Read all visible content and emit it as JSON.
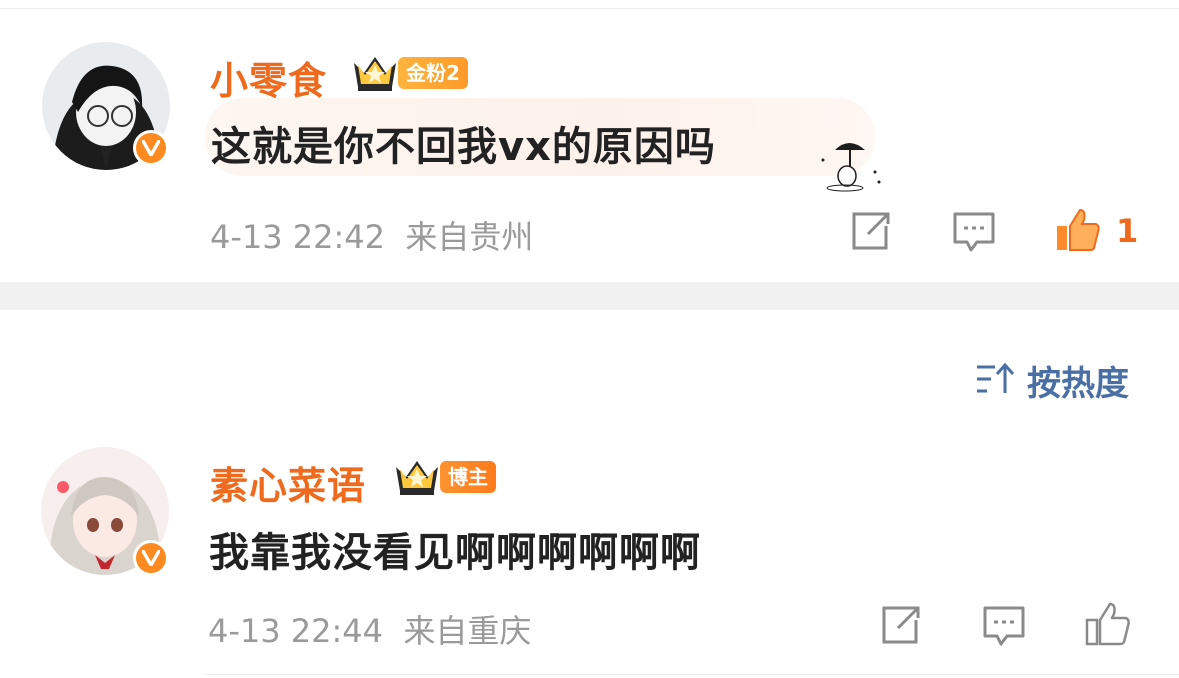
{
  "comments": [
    {
      "username": "小零食",
      "badge": "金粉2",
      "text": "这就是你不回我vx的原因吗",
      "meta": "4-13 22:42  来自贵州",
      "likes": "1"
    },
    {
      "username": "素心菜语",
      "badge": "博主",
      "text": "我靠我没看见啊啊啊啊啊啊",
      "meta": "4-13 22:44  来自重庆",
      "likes": ""
    }
  ],
  "sort": {
    "label": "按热度",
    "icon": "sort-icon"
  },
  "icons": {
    "share": "share-icon",
    "comment": "comment-icon",
    "like": "thumbs-up-icon",
    "verified": "verified-v-icon",
    "crown": "crown-icon"
  },
  "colors": {
    "username": "#ef6a1d",
    "meta": "#9a9a9a",
    "sort": "#4a6fa5",
    "like_active": "#ef6a1d",
    "badge_gold": "#ffb43d",
    "badge_blogger": "#ff8a1f"
  }
}
